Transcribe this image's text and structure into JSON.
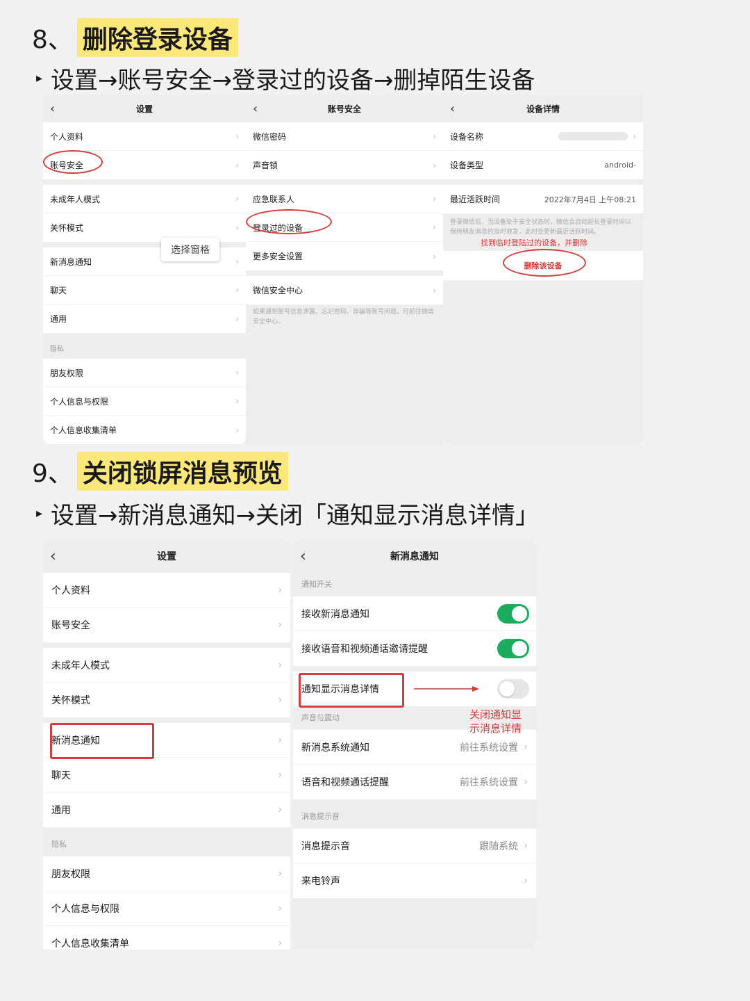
{
  "step8": {
    "number": "8、",
    "title": "删除登录设备",
    "route": "设置→账号安全→登录过的设备→删掉陌生设备"
  },
  "step9": {
    "number": "9、",
    "title": "关闭锁屏消息预览",
    "route": "设置→新消息通知→关闭「通知显示消息详情」"
  },
  "back_glyph": "‹",
  "chevron_glyph": "›",
  "settings_small": {
    "title": "设置",
    "group1": [
      "个人资料",
      "账号安全"
    ],
    "group2": [
      "未成年人模式",
      "关怀模式"
    ],
    "group3": [
      "新消息通知",
      "聊天",
      "通用"
    ],
    "privacy_section": "隐私",
    "group4": [
      "朋友权限",
      "个人信息与权限",
      "个人信息收集清单"
    ],
    "tooltip": "选择窗格"
  },
  "account_security": {
    "title": "账号安全",
    "group1": [
      "微信密码",
      "声音锁"
    ],
    "group2": [
      "应急联系人",
      "登录过的设备",
      "更多安全设置"
    ],
    "group3": [
      "微信安全中心"
    ],
    "note": "如果遇到账号信息泄露、忘记密码、诈骗等账号问题，可前往微信安全中心。"
  },
  "device_detail": {
    "title": "设备详情",
    "name_label": "设备名称",
    "type_label": "设备类型",
    "type_value": "android-",
    "last_active_label": "最近活跃时间",
    "last_active_value": "2022年7月4日 上午08:21",
    "note": "登录微信后，当设备处于安全状态时，微信会自动延长登录时间以保持朋友消息的及时收发，此时会更新最近活跃时间。",
    "annotation": "找到临时登陆过的设备，并删除",
    "delete_button": "删除该设备"
  },
  "settings_large": {
    "title": "设置",
    "group1": [
      "个人资料",
      "账号安全"
    ],
    "group2": [
      "未成年人模式",
      "关怀模式"
    ],
    "group3": [
      "新消息通知",
      "聊天",
      "通用"
    ],
    "privacy_section": "隐私",
    "group4": [
      "朋友权限",
      "个人信息与权限",
      "个人信息收集清单"
    ]
  },
  "new_msg": {
    "title": "新消息通知",
    "section_switch": "通知开关",
    "receive_new": "接收新消息通知",
    "receive_call": "接收语音和视频通话邀请提醒",
    "show_detail": "通知显示消息详情",
    "section_sound": "声音与震动",
    "annotation_line1": "关闭通知显",
    "annotation_line2": "示消息详情",
    "system_notify": "新消息系统通知",
    "system_notify_value": "前往系统设置",
    "call_remind": "语音和视频通话提醒",
    "call_remind_value": "前往系统设置",
    "section_tone": "消息提示音",
    "msg_tone": "消息提示音",
    "msg_tone_value": "跟随系统",
    "ringtone": "来电铃声"
  },
  "colors": {
    "highlight": "#fbe87a",
    "annotation_red": "#d63a3a",
    "toggle_on": "#1aad5e"
  }
}
